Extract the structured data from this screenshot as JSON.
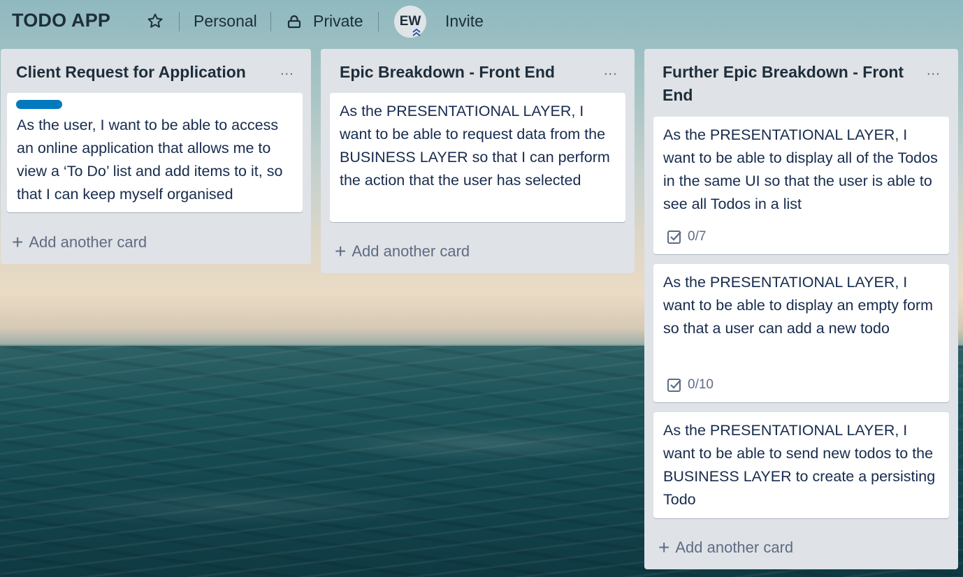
{
  "header": {
    "board_title": "TODO APP",
    "team_label": "Personal",
    "visibility_label": "Private",
    "avatar_initials": "EW",
    "invite_label": "Invite"
  },
  "lists": [
    {
      "title": "Client Request for Application",
      "menu": "...",
      "cards": [
        {
          "text": "As the user, I want to be able to access an online application that allows me to view a ‘To Do’ list and add items to it, so that I can keep myself organised",
          "label_color": "#0079bf"
        }
      ],
      "add_card_label": "Add another card"
    },
    {
      "title": "Epic Breakdown - Front End",
      "menu": "...",
      "cards": [
        {
          "text": "As the PRESENTATIONAL LAYER, I want to be able to request data from the BUSINESS LAYER so that I can perform the action that the user has selected"
        }
      ],
      "add_card_label": "Add another card"
    },
    {
      "title": "Further Epic Breakdown - Front End",
      "menu": "...",
      "cards": [
        {
          "text": "As the PRESENTATIONAL LAYER, I want to be able to display all of the Todos in the same UI so that the user is able to see all Todos in a list",
          "checklist": "0/7"
        },
        {
          "text": "As the PRESENTATIONAL LAYER, I want to be able to display an empty form so that a user can add a new todo",
          "checklist": "0/10"
        },
        {
          "text": "As the PRESENTATIONAL LAYER, I want to be able to send new todos to the BUSINESS LAYER to create a persisting Todo"
        }
      ],
      "add_card_label": "Add another card"
    }
  ],
  "icons": {
    "star": "star-icon",
    "lock": "lock-icon",
    "checklist": "checklist-icon",
    "plus": "plus-icon",
    "admin_badge": "chevrons-up-icon"
  },
  "colors": {
    "label_blue": "#0079bf",
    "list_bg": "#dfe2e6",
    "text_dark": "#172b4d",
    "muted": "#5e6c84"
  }
}
